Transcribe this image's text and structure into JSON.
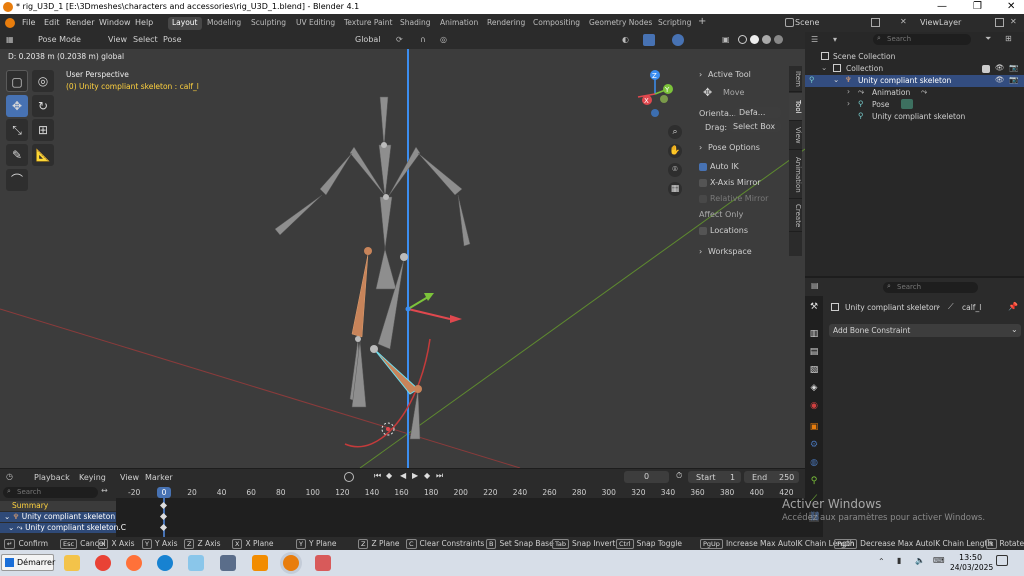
{
  "window": {
    "title": "* rig_U3D_1 [E:\\3Dmeshes\\characters and accessories\\rig_U3D_1.blend] - Blender 4.1",
    "minimize": "—",
    "maximize": "❐",
    "close": "✕"
  },
  "menu": [
    "File",
    "Edit",
    "Render",
    "Window",
    "Help"
  ],
  "workspaces": [
    "Layout",
    "Modeling",
    "Sculpting",
    "UV Editing",
    "Texture Paint",
    "Shading",
    "Animation",
    "Rendering",
    "Compositing",
    "Geometry Nodes",
    "Scripting"
  ],
  "workspace_add": "+",
  "scene": {
    "label": "Scene",
    "viewlayer": "ViewLayer"
  },
  "viewport_header": {
    "mode": "Pose Mode",
    "menus": [
      "View",
      "Select",
      "Pose"
    ],
    "orientation": "Global",
    "search_placeholder": "Search"
  },
  "viewport": {
    "info": "D: 0.2038 m (0.2038 m) global",
    "perspective": "User Perspective",
    "object_info": "(0) Unity compliant skeleton : calf_l",
    "gizmo_axes": {
      "z": "Z",
      "y": "Y",
      "x": "X"
    }
  },
  "npanel": {
    "active_tool_title": "Active Tool",
    "tool_name": "Move",
    "orientation_label": "Orienta...",
    "orientation_value": "Defa...",
    "drag_label": "Drag:",
    "drag_value": "Select Box",
    "pose_options_title": "Pose Options",
    "auto_ik": "Auto IK",
    "x_axis_mirror": "X-Axis Mirror",
    "relative_mirror": "Relative Mirror",
    "affect_only": "Affect Only",
    "locations": "Locations",
    "workspace": "Workspace",
    "tabs": [
      "Item",
      "Tool",
      "View",
      "Animation",
      "Create"
    ]
  },
  "outliner": {
    "search_placeholder": "Search",
    "rows": [
      "Scene Collection",
      "Collection",
      "Unity compliant skeleton",
      "Animation",
      "Pose",
      "Unity compliant skeleton"
    ]
  },
  "properties": {
    "search_placeholder": "Search",
    "breadcrumb_object": "Unity compliant skeleton",
    "breadcrumb_bone": "calf_l",
    "add_constraint": "Add Bone Constraint"
  },
  "timeline": {
    "menus": [
      "Playback",
      "Keying",
      "View",
      "Marker"
    ],
    "current_frame": "0",
    "start_label": "Start",
    "start": "1",
    "end_label": "End",
    "end": "250",
    "search_placeholder": "Search",
    "ticks": [
      "-20",
      "0",
      "20",
      "40",
      "60",
      "80",
      "100",
      "120",
      "140",
      "160",
      "180",
      "200",
      "220",
      "240",
      "260",
      "280",
      "300",
      "320",
      "340",
      "360",
      "380",
      "400",
      "420"
    ],
    "channels": [
      "Summary",
      "Unity compliant skeleton",
      "Unity compliant skeleton.C"
    ]
  },
  "status": [
    {
      "key": "↵",
      "label": "Confirm"
    },
    {
      "key": "Esc",
      "label": "Cancel"
    },
    {
      "key": "X",
      "label": "X Axis"
    },
    {
      "key": "Y",
      "label": "Y Axis"
    },
    {
      "key": "Z",
      "label": "Z Axis"
    },
    {
      "key": "X",
      "label": "X Plane"
    },
    {
      "key": "Y",
      "label": "Y Plane"
    },
    {
      "key": "Z",
      "label": "Z Plane"
    },
    {
      "key": "C",
      "label": "Clear Constraints"
    },
    {
      "key": "B",
      "label": "Set Snap Base"
    },
    {
      "key": "Tab",
      "label": "Snap Invert"
    },
    {
      "key": "Ctrl",
      "label": "Snap Toggle"
    },
    {
      "key": "PgUp",
      "label": "Increase Max AutoIK Chain Length"
    },
    {
      "key": "PgDn",
      "label": "Decrease Max AutoIK Chain Length"
    },
    {
      "key": "R",
      "label": "Rotate"
    }
  ],
  "watermark": {
    "title": "Activer Windows",
    "subtitle": "Accédez aux paramètres pour activer Windows."
  },
  "taskbar": {
    "start": "Démarrer",
    "time": "13:50",
    "date": "24/03/2025"
  },
  "colors": {
    "accent": "#4772b3",
    "bone_selected": "#c8845a",
    "axis_x": "#e0484e",
    "axis_y": "#7cc33a",
    "axis_z": "#3c8ef0"
  }
}
